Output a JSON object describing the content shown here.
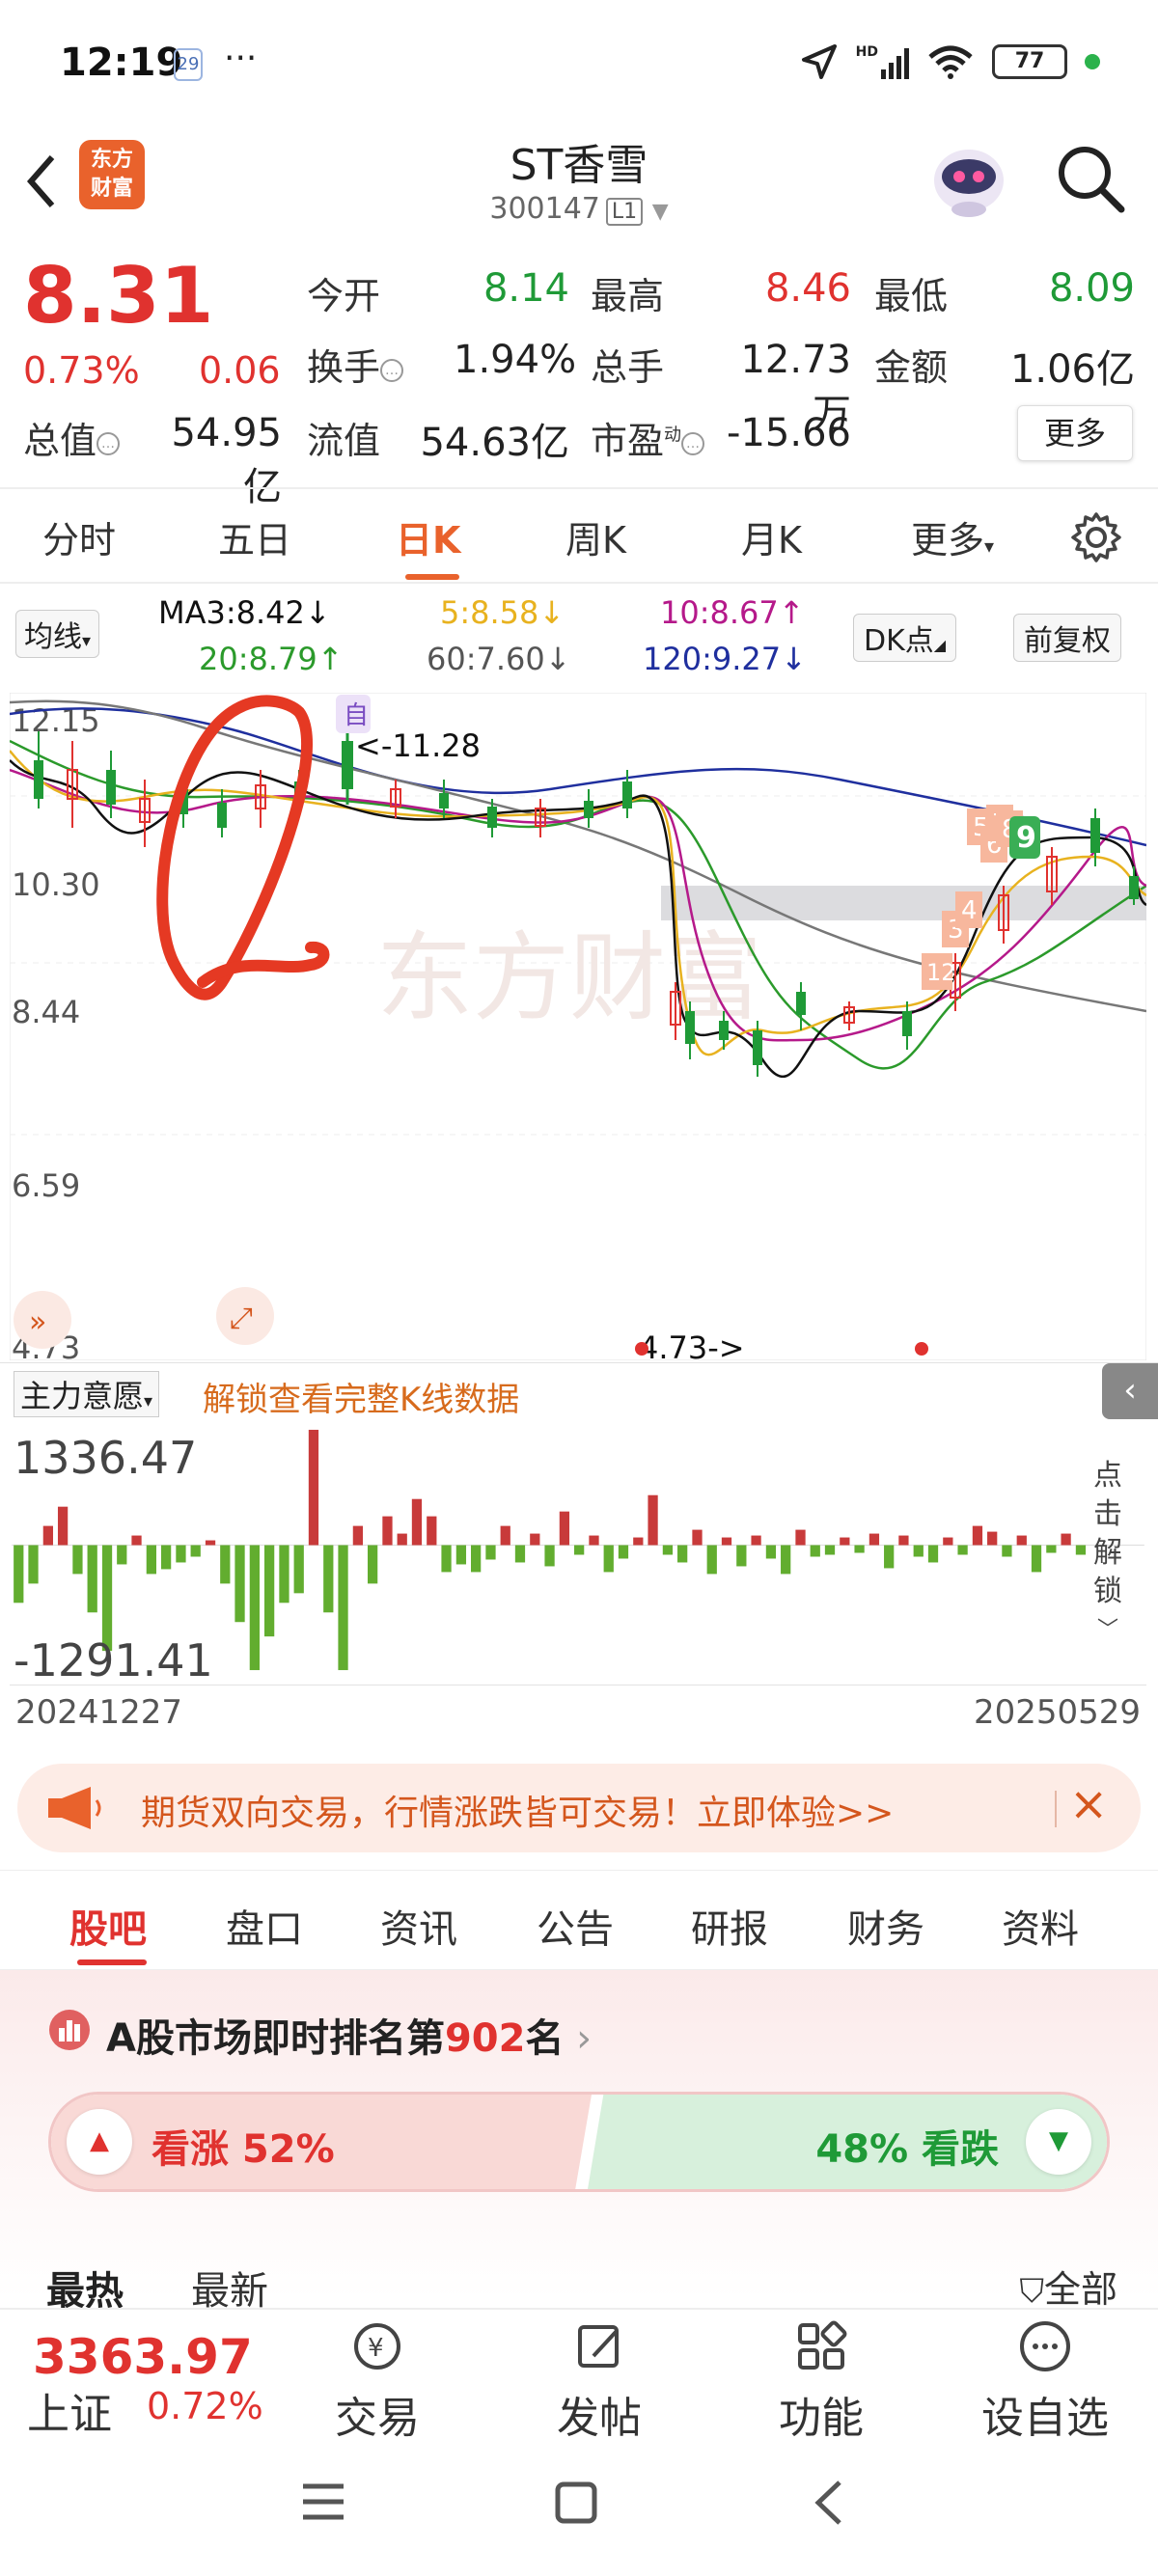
{
  "status_bar": {
    "time": "12:19",
    "calendar": "29",
    "dots": "···",
    "network": "HD",
    "battery": "77"
  },
  "header": {
    "title": "ST香雪",
    "code": "300147",
    "level": "L1",
    "logo": "东方\n财富"
  },
  "quote": {
    "price": "8.31",
    "change_pct": "0.73%",
    "change_abs": "0.06",
    "open_label": "今开",
    "open": "8.14",
    "high_label": "最高",
    "high": "8.46",
    "low_label": "最低",
    "low": "8.09",
    "turnover_label": "换手",
    "turnover": "1.94%",
    "volume_label": "总手",
    "volume": "12.73万",
    "amount_label": "金额",
    "amount": "1.06亿",
    "mcap_label": "总值",
    "mcap": "54.95亿",
    "float_label": "流值",
    "float": "54.63亿",
    "pe_label": "市盈",
    "pe_sup": "动",
    "pe": "-15.66",
    "more": "更多"
  },
  "period_tabs": [
    "分时",
    "五日",
    "日K",
    "周K",
    "月K",
    "更多"
  ],
  "active_period": "日K",
  "ma": {
    "select": "均线",
    "ma3": "MA3:8.42↓",
    "ma5": "5:8.58↓",
    "ma10": "10:8.67↑",
    "ma20": "20:8.79↑",
    "ma60": "60:7.60↓",
    "ma120": "120:9.27↓",
    "dk": "DK点",
    "adjust": "前复权",
    "colors": {
      "ma3": "#111111",
      "ma5": "#e8b21f",
      "ma10": "#b5198a",
      "ma20": "#2b9a2b",
      "ma60": "#777777",
      "ma120": "#1f2f9e"
    }
  },
  "chart": {
    "y_labels": [
      "12.15",
      "10.30",
      "8.44",
      "6.59",
      "4.73"
    ],
    "high_annotation": "<-11.28",
    "low_annotation": "4.73->",
    "badge": "自",
    "watermark": "东方财富",
    "dk_marks": [
      "12",
      "3",
      "4",
      "5",
      "6",
      "7",
      "8",
      "9"
    ]
  },
  "indicator": {
    "select": "主力意愿",
    "unlock": "解锁查看完整K线数据",
    "max": "1336.47",
    "min": "-1291.41",
    "side": [
      "点",
      "击",
      "解",
      "锁"
    ],
    "date_start": "20241227",
    "date_end": "20250529"
  },
  "banner": {
    "text": "期货双向交易，行情涨跌皆可交易！立即体验>>"
  },
  "info_tabs": [
    "股吧",
    "盘口",
    "资讯",
    "公告",
    "研报",
    "财务",
    "资料"
  ],
  "rank": {
    "prefix": "A股市场即时排名第",
    "rank": "902",
    "suffix": "名"
  },
  "vote": {
    "up": "看涨 52%",
    "down": "48% 看跌",
    "up_fraction": 0.52
  },
  "sort": {
    "hot": "最热",
    "new": "最新",
    "filter": "全部"
  },
  "bottom_nav": {
    "index_value": "3363.97",
    "index_name": "上证",
    "index_pct": "0.72%",
    "items": [
      "交易",
      "发帖",
      "功能",
      "设自选"
    ]
  }
}
